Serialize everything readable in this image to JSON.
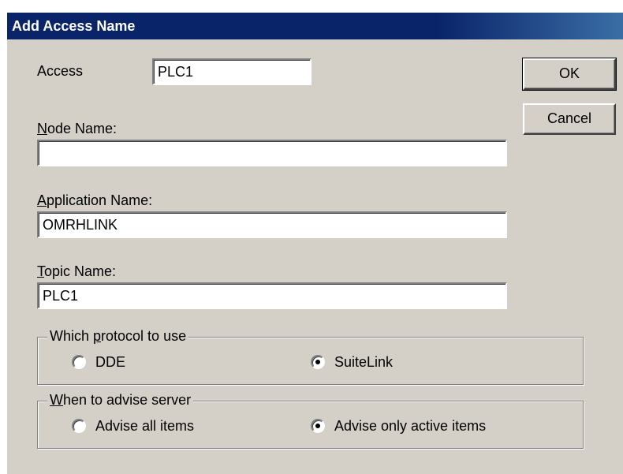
{
  "window": {
    "title": "Add Access Name"
  },
  "access": {
    "label": "Access",
    "value": "PLC1"
  },
  "node_name": {
    "label_key": "N",
    "label_rest": "ode Name:",
    "value": ""
  },
  "application_name": {
    "label_key": "A",
    "label_rest": "pplication Name:",
    "value": "OMRHLINK"
  },
  "topic_name": {
    "label_key": "T",
    "label_rest": "opic Name:",
    "value": "PLC1"
  },
  "buttons": {
    "ok": "OK",
    "cancel": "Cancel"
  },
  "protocol_group": {
    "legend_pre": "Which ",
    "legend_key": "p",
    "legend_rest": "rotocol to use",
    "options": [
      {
        "label": "DDE",
        "selected": false
      },
      {
        "label": "SuiteLink",
        "selected": true
      }
    ]
  },
  "advise_group": {
    "legend_key": "W",
    "legend_rest": "hen to advise server",
    "options": [
      {
        "label": "Advise all items",
        "selected": false
      },
      {
        "label": "Advise only active items",
        "selected": true
      }
    ]
  }
}
